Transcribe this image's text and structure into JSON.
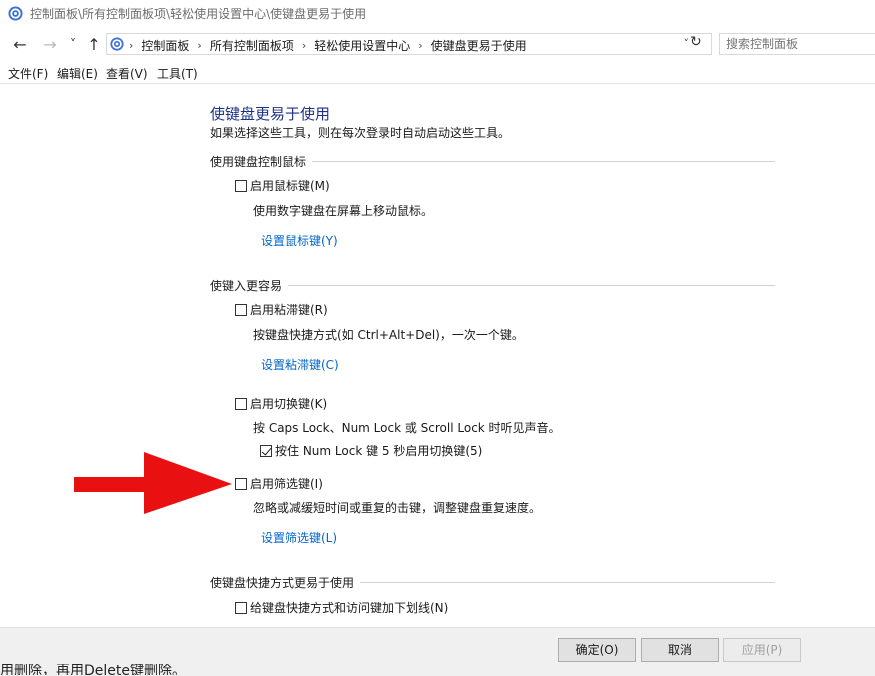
{
  "window": {
    "title": "控制面板\\所有控制面板项\\轻松使用设置中心\\使键盘更易于使用"
  },
  "nav": {
    "back": "←",
    "forward": "→",
    "recent": "˅",
    "up": "↑",
    "breadcrumbs": [
      "控制面板",
      "所有控制面板项",
      "轻松使用设置中心",
      "使键盘更易于使用"
    ],
    "dropdown": "˅",
    "refresh": "↻",
    "search_placeholder": "搜索控制面板"
  },
  "menu": {
    "items": [
      "文件(F)",
      "编辑(E)",
      "查看(V)",
      "工具(T)"
    ]
  },
  "page": {
    "title": "使键盘更易于使用",
    "subtitle": "如果选择这些工具，则在每次登录时自动启动这些工具。"
  },
  "sections": {
    "mouse": {
      "heading": "使用键盘控制鼠标",
      "mousekeys_label": "启用鼠标键(M)",
      "mousekeys_desc": "使用数字键盘在屏幕上移动鼠标。",
      "mousekeys_link": "设置鼠标键(Y)"
    },
    "typing": {
      "heading": "使键入更容易",
      "sticky_label": "启用粘滞键(R)",
      "sticky_desc": "按键盘快捷方式(如 Ctrl+Alt+Del)，一次一个键。",
      "sticky_link": "设置粘滞键(C)",
      "toggle_label": "启用切换键(K)",
      "toggle_desc": "按 Caps Lock、Num Lock 或 Scroll Lock 时听见声音。",
      "toggle_numlock_label": "按住 Num Lock 键 5 秒启用切换键(5)",
      "filter_label": "启用筛选键(I)",
      "filter_desc": "忽略或减缓短时间或重复的击键，调整键盘重复速度。",
      "filter_link": "设置筛选键(L)"
    },
    "shortcuts": {
      "heading": "使键盘快捷方式更易于使用",
      "underline_label": "给键盘快捷方式和访问键加下划线(N)"
    }
  },
  "buttons": {
    "ok": "确定(O)",
    "cancel": "取消",
    "apply": "应用(P)"
  },
  "background_text": "用删除，再用Delete键删除。",
  "colors": {
    "title_blue": "#1e3287",
    "link_blue": "#0066cc",
    "arrow_red": "#e81010"
  }
}
